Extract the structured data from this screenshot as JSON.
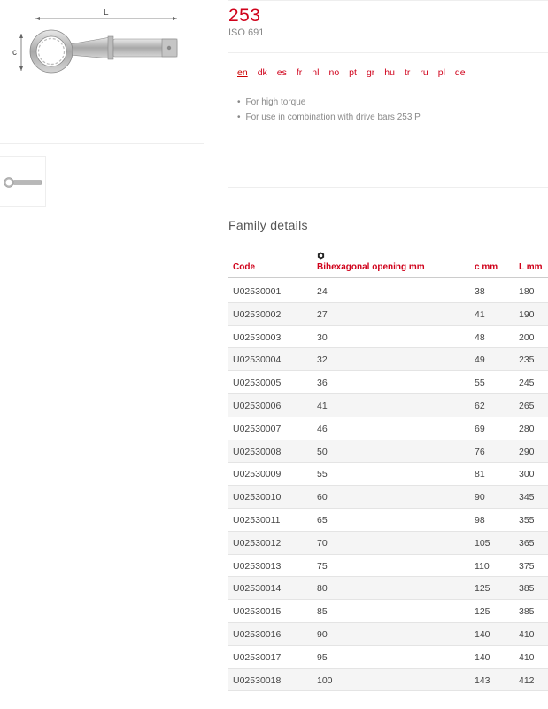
{
  "product": {
    "title": "253",
    "standard": "ISO 691"
  },
  "image": {
    "dim_length_label": "L",
    "dim_c_label": "c"
  },
  "languages": [
    "en",
    "dk",
    "es",
    "fr",
    "nl",
    "no",
    "pt",
    "gr",
    "hu",
    "tr",
    "ru",
    "pl",
    "de"
  ],
  "active_language": "en",
  "features": [
    "For high torque",
    "For use in combination with drive bars 253 P"
  ],
  "family": {
    "title": "Family details",
    "opening_icon": "hexagon-nut-icon",
    "headers": {
      "code": "Code",
      "opening": "Bihexagonal opening mm",
      "c": "c mm",
      "l": "L mm"
    },
    "rows": [
      {
        "code": "U02530001",
        "opening": "24",
        "c": "38",
        "l": "180"
      },
      {
        "code": "U02530002",
        "opening": "27",
        "c": "41",
        "l": "190"
      },
      {
        "code": "U02530003",
        "opening": "30",
        "c": "48",
        "l": "200"
      },
      {
        "code": "U02530004",
        "opening": "32",
        "c": "49",
        "l": "235"
      },
      {
        "code": "U02530005",
        "opening": "36",
        "c": "55",
        "l": "245"
      },
      {
        "code": "U02530006",
        "opening": "41",
        "c": "62",
        "l": "265"
      },
      {
        "code": "U02530007",
        "opening": "46",
        "c": "69",
        "l": "280"
      },
      {
        "code": "U02530008",
        "opening": "50",
        "c": "76",
        "l": "290"
      },
      {
        "code": "U02530009",
        "opening": "55",
        "c": "81",
        "l": "300"
      },
      {
        "code": "U02530010",
        "opening": "60",
        "c": "90",
        "l": "345"
      },
      {
        "code": "U02530011",
        "opening": "65",
        "c": "98",
        "l": "355"
      },
      {
        "code": "U02530012",
        "opening": "70",
        "c": "105",
        "l": "365"
      },
      {
        "code": "U02530013",
        "opening": "75",
        "c": "110",
        "l": "375"
      },
      {
        "code": "U02530014",
        "opening": "80",
        "c": "125",
        "l": "385"
      },
      {
        "code": "U02530015",
        "opening": "85",
        "c": "125",
        "l": "385"
      },
      {
        "code": "U02530016",
        "opening": "90",
        "c": "140",
        "l": "410"
      },
      {
        "code": "U02530017",
        "opening": "95",
        "c": "140",
        "l": "410"
      },
      {
        "code": "U02530018",
        "opening": "100",
        "c": "143",
        "l": "412"
      }
    ]
  },
  "colors": {
    "accent": "#d0021b"
  }
}
